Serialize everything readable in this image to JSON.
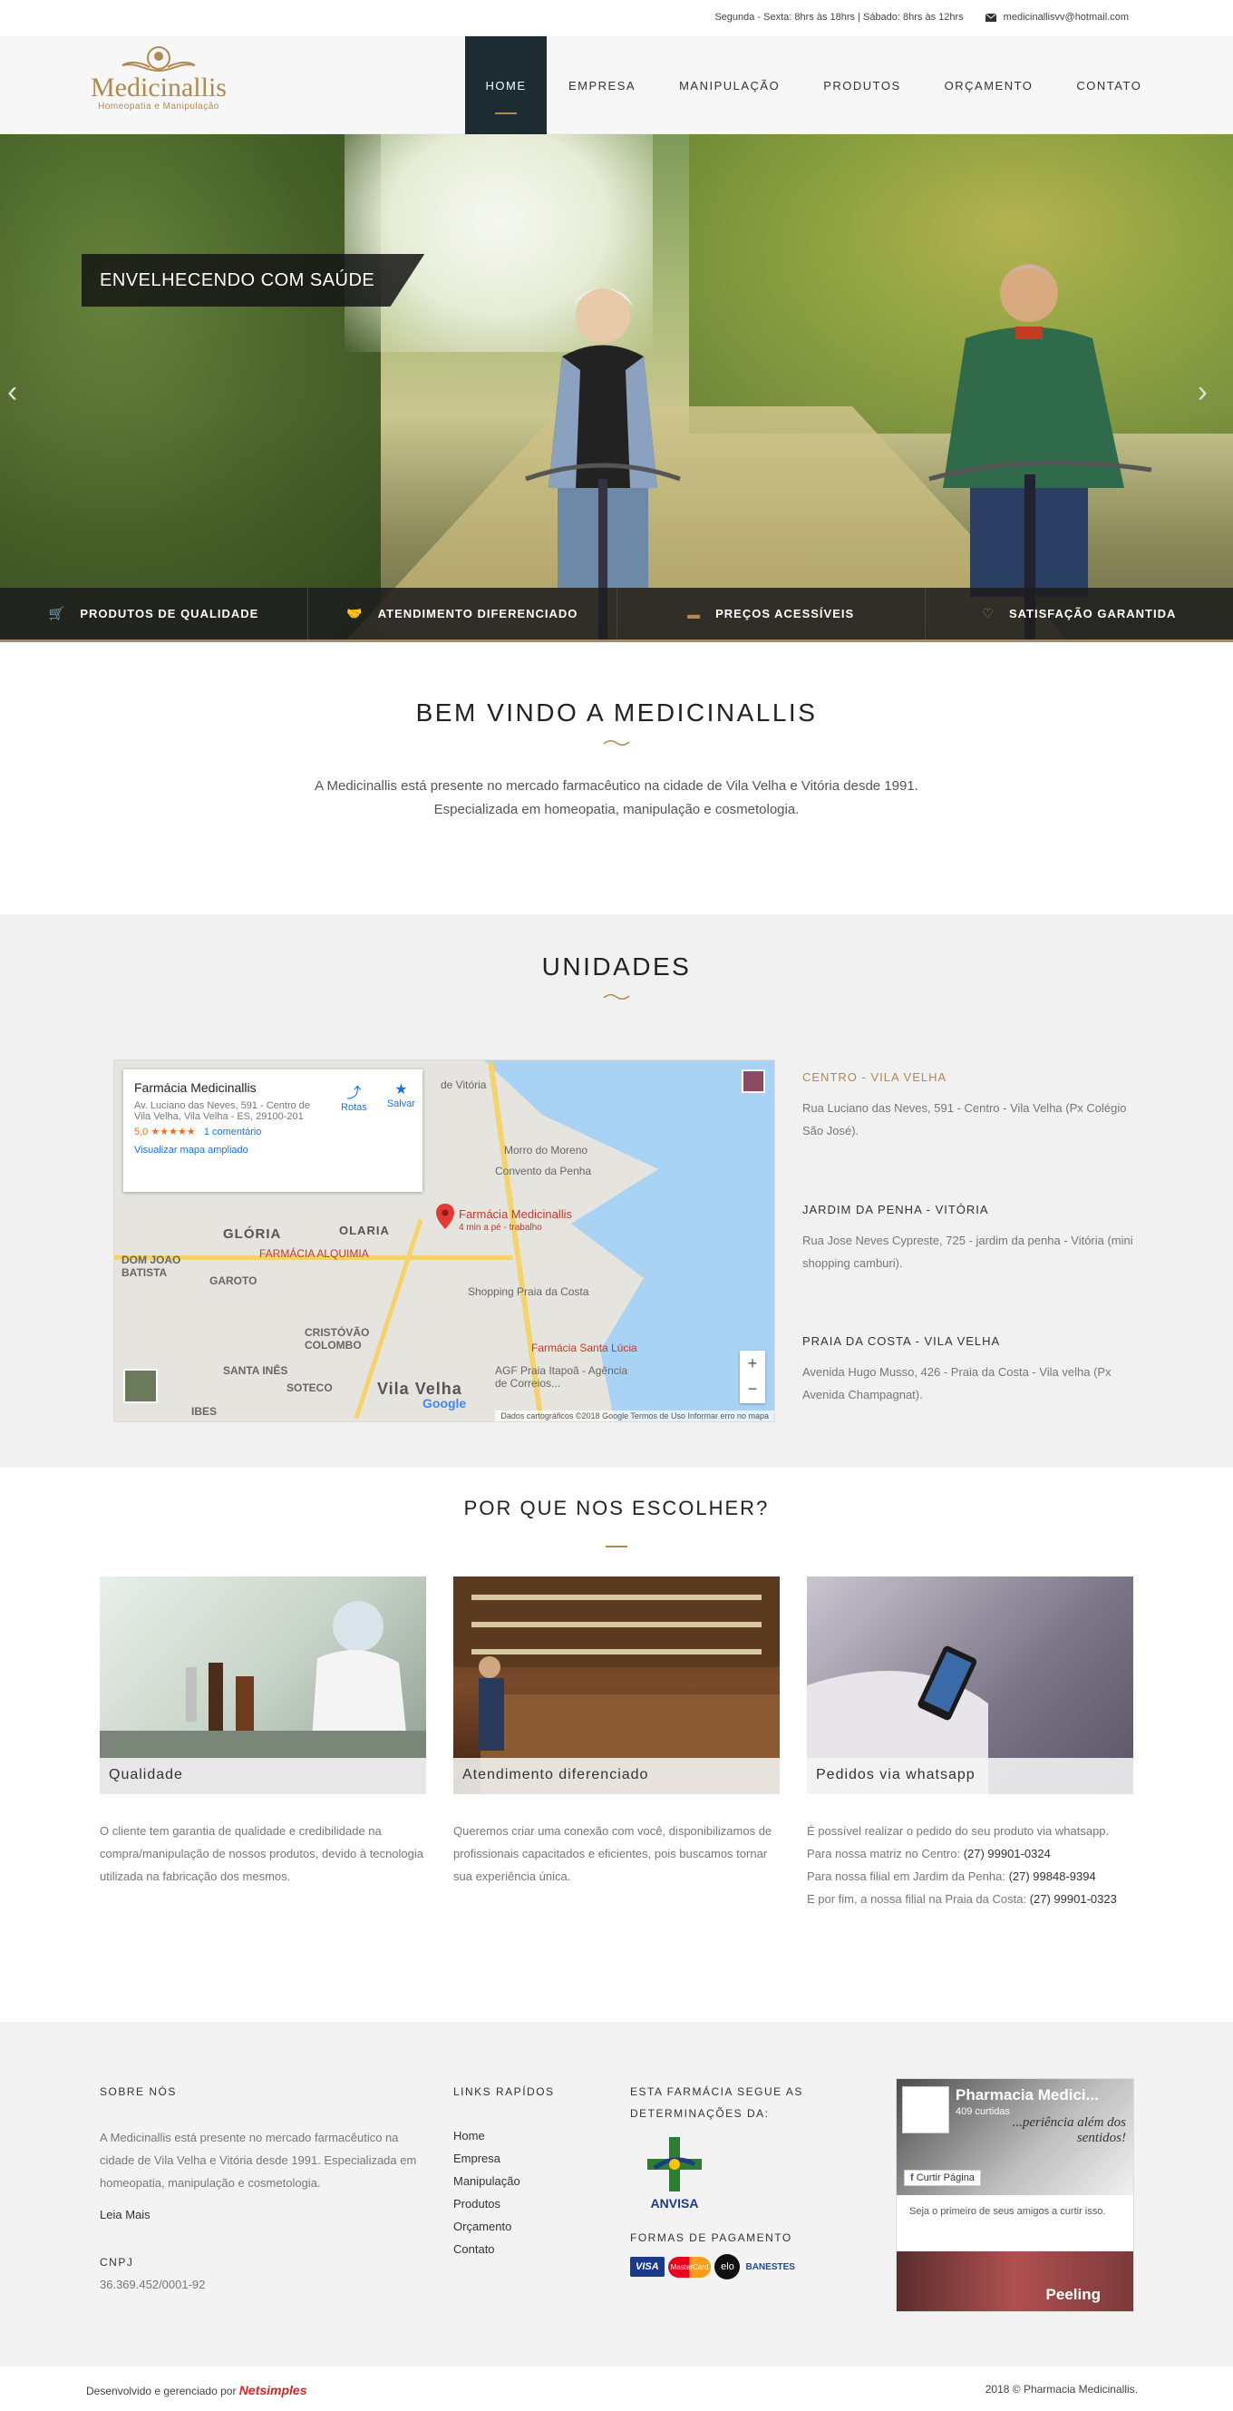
{
  "topbar": {
    "hours": "Segunda - Sexta: 8hrs às 18hrs | Sábado: 8hrs às 12hrs",
    "email": "medicinallisvv@hotmail.com"
  },
  "logo": {
    "name": "Medicinallis",
    "tagline": "Homeopatia e Manipulação"
  },
  "nav": [
    {
      "label": "HOME"
    },
    {
      "label": "EMPRESA"
    },
    {
      "label": "MANIPULAÇÃO"
    },
    {
      "label": "PRODUTOS"
    },
    {
      "label": "ORÇAMENTO"
    },
    {
      "label": "CONTATO"
    }
  ],
  "hero": {
    "caption": "ENVELHECENDO COM SAÚDE",
    "prev": "‹",
    "next": "›",
    "features": [
      {
        "icon": "cart-icon",
        "label": "PRODUTOS DE QUALIDADE"
      },
      {
        "icon": "handshake-icon",
        "label": "ATENDIMENTO DIFERENCIADO"
      },
      {
        "icon": "money-icon",
        "label": "PREÇOS ACESSÍVEIS"
      },
      {
        "icon": "heart-icon",
        "label": "SATISFAÇÃO GARANTIDA"
      }
    ]
  },
  "welcome": {
    "title": "BEM VINDO A MEDICINALLIS",
    "line1": "A Medicinallis está presente no mercado farmacêutico na cidade de Vila Velha e Vitória desde 1991.",
    "line2": "Especializada em homeopatia, manipulação e cosmetologia."
  },
  "units": {
    "title": "UNIDADES",
    "map": {
      "card_title": "Farmácia Medicinallis",
      "card_address": "Av. Luciano das Neves, 591 - Centro de Vila Velha, Vila Velha - ES, 29100-201",
      "rating": "5,0 ★★★★★",
      "reviews": "1 comentário",
      "enlarge": "Visualizar mapa ampliado",
      "routes": "Rotas",
      "save": "Salvar",
      "pin_name": "Farmácia Medicinallis",
      "pin_sub": "4 min a pé - trabalho",
      "labels": [
        "GLÓRIA",
        "OLARIA",
        "FARMÁCIA ALQUIMIA",
        "DOM JOAO BATISTA",
        "GAROTO",
        "CRISTÓVÃO COLOMBO",
        "SANTA INÊS",
        "SOTECO",
        "Vila Velha",
        "IBES",
        "Morro do Moreno",
        "Convento da Penha",
        "Shopping Praia da Costa",
        "Farmácia Santa Lúcia",
        "AGF Praia Itapoã - Agência de Correios...",
        "de Vitória"
      ],
      "attribution": "Dados cartográficos ©2018 Google   Termos de Uso   Informar erro no mapa",
      "google": "Google"
    },
    "locations": [
      {
        "title": "CENTRO - VILA VELHA",
        "address": "Rua Luciano das Neves, 591 - Centro - Vila Velha (Px Colégio São José)."
      },
      {
        "title": "JARDIM DA PENHA - VITÓRIA",
        "address": "Rua Jose Neves Cypreste, 725 - jardim da penha - Vitória (mini shopping camburi)."
      },
      {
        "title": "PRAIA DA COSTA - VILA VELHA",
        "address": "Avenida Hugo Musso, 426 - Praia da Costa - Vila velha (Px Avenida Champagnat)."
      }
    ]
  },
  "why": {
    "title": "POR QUE NOS ESCOLHER?",
    "cards": [
      {
        "caption": "Qualidade",
        "text": "O cliente tem garantia de qualidade e credibilidade na compra/manipulação de nossos produtos, devido à tecnologia utilizada na fabricação dos mesmos."
      },
      {
        "caption": "Atendimento diferenciado",
        "text": "Queremos criar uma conexão com você, disponibilizamos de profissionais capacitados e eficientes, pois buscamos tornar sua experiência única."
      },
      {
        "caption": "Pedidos via whatsapp",
        "text": "É possível realizar o pedido do seu produto via whatsapp.",
        "l1": "Para nossa matriz no Centro: ",
        "p1": "(27) 99901-0324",
        "l2": "Para nossa filial em Jardim da Penha: ",
        "p2": "(27) 99848-9394",
        "l3": "E por fim, a nossa filial na Praia da Costa: ",
        "p3": "(27) 99901-0323"
      }
    ]
  },
  "footer": {
    "about_title": "SOBRE NÓS",
    "about_text": "A Medicinallis está presente no mercado farmacêutico na cidade de Vila Velha e Vitória desde 1991. Especializada em homeopatia, manipulação e cosmetologia.",
    "read_more": "Leia Mais",
    "cnpj_label": "CNPJ",
    "cnpj": "36.369.452/0001-92",
    "links_title": "LINKS RAPÍDOS",
    "links": [
      "Home",
      "Empresa",
      "Manipulação",
      "Produtos",
      "Orçamento",
      "Contato"
    ],
    "anvisa_title": "ESTA FARMÁCIA SEGUE AS DETERMINAÇÕES DA:",
    "anvisa": "ANVISA",
    "payment_title": "FORMAS DE PAGAMENTO",
    "payments": [
      "VISA",
      "MasterCard",
      "elo",
      "BANESTES"
    ],
    "fb": {
      "page": "Pharmacia Medici...",
      "likes": "409 curtidas",
      "tagline": "...periência além dos sentidos!",
      "like_btn": "Curtir Página",
      "friends": "Seja o primeiro de seus amigos a curtir isso.",
      "peeling": "Peeling"
    }
  },
  "bottom": {
    "dev": "Desenvolvido e gerenciado por",
    "brand": "Netsimples",
    "copy": "2018 © Pharmacia Medicinallis."
  }
}
